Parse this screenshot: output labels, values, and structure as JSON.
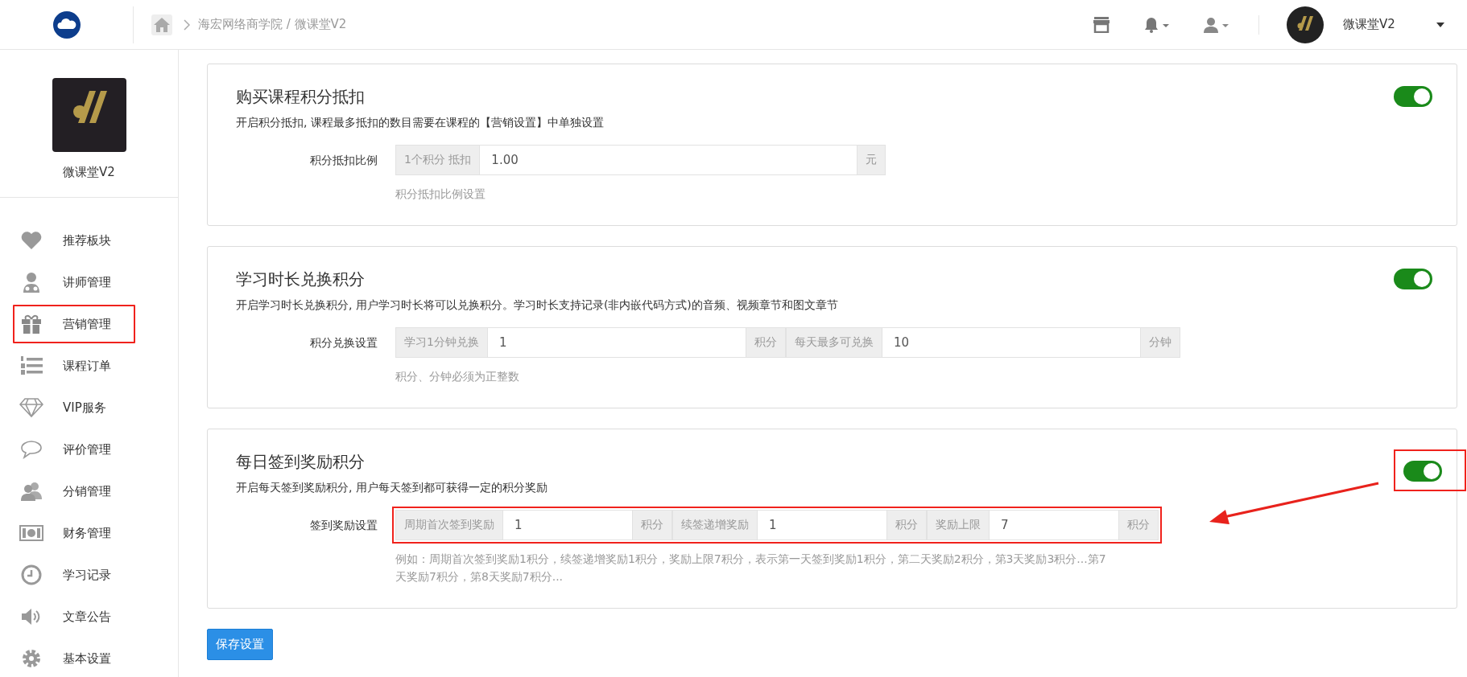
{
  "topbar": {
    "breadcrumb": "海宏网络商学院 / 微课堂V2",
    "user_name": "微课堂V2"
  },
  "sidebar": {
    "shop_name": "微课堂V2",
    "items": [
      {
        "label": "推荐板块",
        "annotated": false
      },
      {
        "label": "讲师管理",
        "annotated": false
      },
      {
        "label": "营销管理",
        "annotated": true
      },
      {
        "label": "课程订单",
        "annotated": false
      },
      {
        "label": "VIP服务",
        "annotated": false
      },
      {
        "label": "评价管理",
        "annotated": false
      },
      {
        "label": "分销管理",
        "annotated": false
      },
      {
        "label": "财务管理",
        "annotated": false
      },
      {
        "label": "学习记录",
        "annotated": false
      },
      {
        "label": "文章公告",
        "annotated": false
      },
      {
        "label": "基本设置",
        "annotated": false
      }
    ]
  },
  "settings": [
    {
      "title": "购买课程积分抵扣",
      "description": "开启积分抵扣, 课程最多抵扣的数目需要在课程的【营销设置】中单独设置",
      "enabled": true,
      "toggle_annotated": false,
      "row_label": "积分抵扣比例",
      "group_annotated": false,
      "fields": [
        {
          "kind": "addon",
          "text": "1个积分 抵扣"
        },
        {
          "kind": "input",
          "value": "1.00"
        },
        {
          "kind": "addon",
          "text": "元"
        }
      ],
      "help": "积分抵扣比例设置"
    },
    {
      "title": "学习时长兑换积分",
      "description": "开启学习时长兑换积分, 用户学习时长将可以兑换积分。学习时长支持记录(非内嵌代码方式)的音频、视频章节和图文章节",
      "enabled": true,
      "toggle_annotated": false,
      "row_label": "积分兑换设置",
      "group_annotated": false,
      "fields": [
        {
          "kind": "addon",
          "text": "学习1分钟兑换"
        },
        {
          "kind": "input",
          "value": "1"
        },
        {
          "kind": "addon",
          "text": "积分"
        },
        {
          "kind": "addon",
          "text": "每天最多可兑换"
        },
        {
          "kind": "input",
          "value": "10"
        },
        {
          "kind": "addon",
          "text": "分钟"
        }
      ],
      "help": "积分、分钟必须为正整数"
    },
    {
      "title": "每日签到奖励积分",
      "description": "开启每天签到奖励积分, 用户每天签到都可获得一定的积分奖励",
      "enabled": true,
      "toggle_annotated": true,
      "row_label": "签到奖励设置",
      "group_annotated": true,
      "fields": [
        {
          "kind": "addon",
          "text": "周期首次签到奖励"
        },
        {
          "kind": "input",
          "value": "1"
        },
        {
          "kind": "addon",
          "text": "积分"
        },
        {
          "kind": "addon",
          "text": "续签递增奖励"
        },
        {
          "kind": "input",
          "value": "1"
        },
        {
          "kind": "addon",
          "text": "积分"
        },
        {
          "kind": "addon",
          "text": "奖励上限"
        },
        {
          "kind": "input",
          "value": "7"
        },
        {
          "kind": "addon",
          "text": "积分"
        }
      ],
      "help": "例如：周期首次签到奖励1积分，续签递增奖励1积分，奖励上限7积分，表示第一天签到奖励1积分，第二天奖励2积分，第3天奖励3积分...第7天奖励7积分，第8天奖励7积分..."
    }
  ],
  "save_button": "保存设置"
}
